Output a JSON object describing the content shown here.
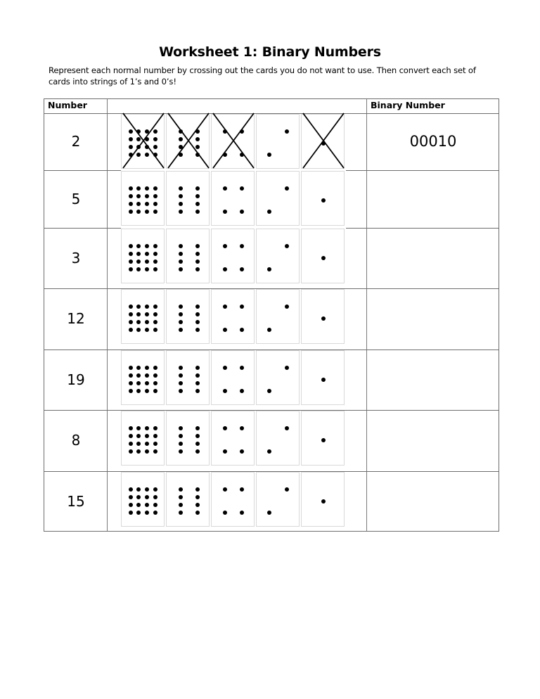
{
  "title": "Worksheet 1: Binary Numbers",
  "instructions": "Represent each normal number by crossing out the cards you do not want to use. Then convert each set of cards into strings of 1’s and 0’s!",
  "table": {
    "headers": {
      "number": "Number",
      "cards": "",
      "binary": "Binary Number"
    },
    "card_values": [
      16,
      8,
      4,
      2,
      1
    ],
    "rows": [
      {
        "number": "2",
        "binary": "00010",
        "crossed": [
          true,
          true,
          true,
          false,
          true
        ]
      },
      {
        "number": "5",
        "binary": "",
        "crossed": [
          false,
          false,
          false,
          false,
          false
        ]
      },
      {
        "number": "3",
        "binary": "",
        "crossed": [
          false,
          false,
          false,
          false,
          false
        ]
      },
      {
        "number": "12",
        "binary": "",
        "crossed": [
          false,
          false,
          false,
          false,
          false
        ]
      },
      {
        "number": "19",
        "binary": "",
        "crossed": [
          false,
          false,
          false,
          false,
          false
        ]
      },
      {
        "number": "8",
        "binary": "",
        "crossed": [
          false,
          false,
          false,
          false,
          false
        ]
      },
      {
        "number": "15",
        "binary": "",
        "crossed": [
          false,
          false,
          false,
          false,
          false
        ]
      }
    ]
  }
}
